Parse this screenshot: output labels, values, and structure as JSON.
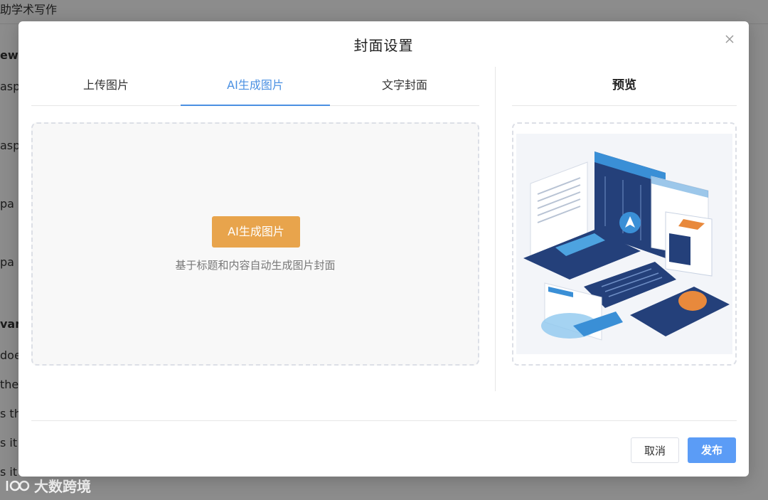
{
  "background": {
    "header_title": "助学术写作",
    "lines": [
      "ew",
      "asp",
      "asp",
      "pa",
      "pa",
      "van",
      "doe",
      "the",
      "s th",
      "s it",
      "s it"
    ]
  },
  "watermark": {
    "text": "大数跨境"
  },
  "modal": {
    "title": "封面设置",
    "tabs": [
      {
        "label": "上传图片",
        "active": false
      },
      {
        "label": "AI生成图片",
        "active": true
      },
      {
        "label": "文字封面",
        "active": false
      }
    ],
    "ai_button_label": "AI生成图片",
    "ai_hint": "基于标题和内容自动生成图片封面",
    "preview_title": "预览",
    "cancel_label": "取消",
    "publish_label": "发布"
  },
  "colors": {
    "accent": "#4a90e2",
    "ai_button": "#e8a44c",
    "publish_button": "#5b9cf6",
    "overlay": "rgba(0,0,0,0.45)"
  },
  "icons": {
    "close": "close-icon",
    "watermark": "watermark-logo-icon"
  }
}
